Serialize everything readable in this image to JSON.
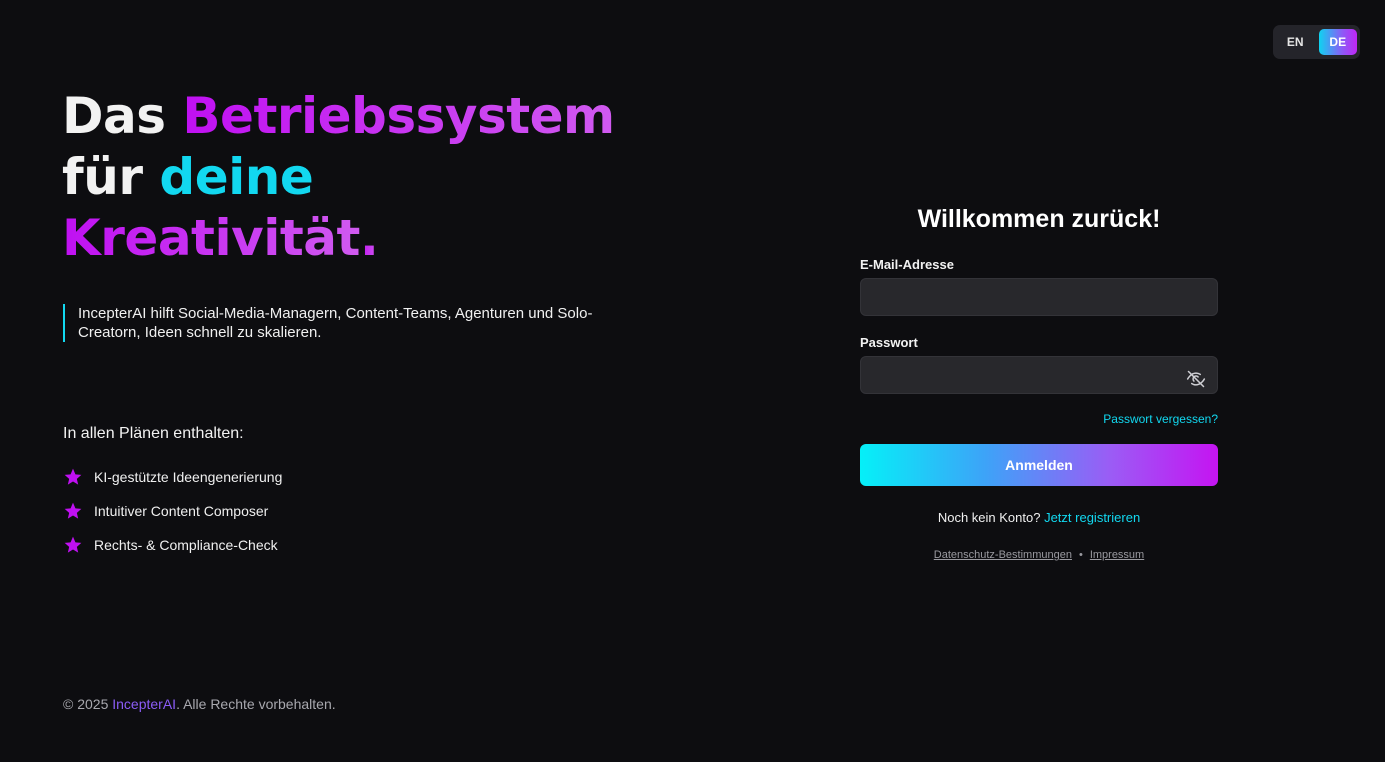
{
  "language_toggle": {
    "options": [
      "EN",
      "DE"
    ],
    "active": "DE"
  },
  "headline": {
    "line1_white": "Das ",
    "line1_accent": "Betriebssystem",
    "line2_white": "für ",
    "line2_accent": "deine",
    "line3_accent": "Kreativität",
    "line3_end": "."
  },
  "tagline": "IncepterAI hilft Social-Media-Managern, Content-Teams, Agenturen und Solo-Creatorn, Ideen schnell zu skalieren.",
  "features": {
    "title": "In allen Plänen enthalten:",
    "items": [
      "KI-gestützte Ideengenerierung",
      "Intuitiver Content Composer",
      "Rechts- & Compliance-Check"
    ]
  },
  "footer": {
    "prefix": "© 2025 ",
    "brand": "IncepterAI",
    "suffix": ". Alle Rechte vorbehalten."
  },
  "login": {
    "title": "Willkommen zurück!",
    "email_label": "E-Mail-Adresse",
    "email_value": "",
    "password_label": "Passwort",
    "password_value": "",
    "forgot_link": "Passwort vergessen?",
    "submit_label": "Anmelden",
    "register_prompt": "Noch kein Konto?",
    "register_link": "Jetzt registrieren",
    "privacy_link": "Datenschutz-Bestimmungen",
    "separator": "•",
    "imprint_link": "Impressum"
  },
  "colors": {
    "background": "#0d0d10",
    "accent_cyan": "#12d8f0",
    "accent_purple": "#c010f2",
    "input_bg": "#28282c"
  },
  "icons": {
    "feature_bullet": "star-icon",
    "password_toggle": "eye-off-icon"
  }
}
